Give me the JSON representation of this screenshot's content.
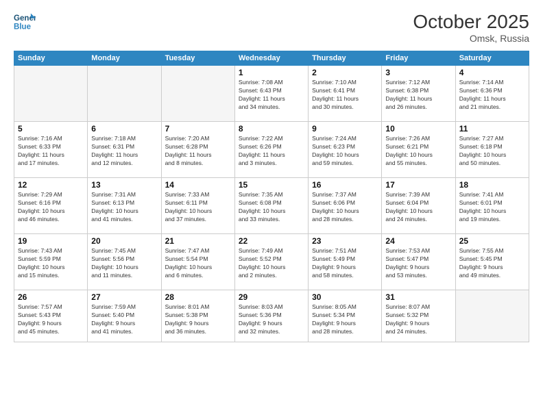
{
  "header": {
    "logo_line1": "General",
    "logo_line2": "Blue",
    "month": "October 2025",
    "location": "Omsk, Russia"
  },
  "weekdays": [
    "Sunday",
    "Monday",
    "Tuesday",
    "Wednesday",
    "Thursday",
    "Friday",
    "Saturday"
  ],
  "weeks": [
    [
      {
        "day": "",
        "info": ""
      },
      {
        "day": "",
        "info": ""
      },
      {
        "day": "",
        "info": ""
      },
      {
        "day": "1",
        "info": "Sunrise: 7:08 AM\nSunset: 6:43 PM\nDaylight: 11 hours\nand 34 minutes."
      },
      {
        "day": "2",
        "info": "Sunrise: 7:10 AM\nSunset: 6:41 PM\nDaylight: 11 hours\nand 30 minutes."
      },
      {
        "day": "3",
        "info": "Sunrise: 7:12 AM\nSunset: 6:38 PM\nDaylight: 11 hours\nand 26 minutes."
      },
      {
        "day": "4",
        "info": "Sunrise: 7:14 AM\nSunset: 6:36 PM\nDaylight: 11 hours\nand 21 minutes."
      }
    ],
    [
      {
        "day": "5",
        "info": "Sunrise: 7:16 AM\nSunset: 6:33 PM\nDaylight: 11 hours\nand 17 minutes."
      },
      {
        "day": "6",
        "info": "Sunrise: 7:18 AM\nSunset: 6:31 PM\nDaylight: 11 hours\nand 12 minutes."
      },
      {
        "day": "7",
        "info": "Sunrise: 7:20 AM\nSunset: 6:28 PM\nDaylight: 11 hours\nand 8 minutes."
      },
      {
        "day": "8",
        "info": "Sunrise: 7:22 AM\nSunset: 6:26 PM\nDaylight: 11 hours\nand 3 minutes."
      },
      {
        "day": "9",
        "info": "Sunrise: 7:24 AM\nSunset: 6:23 PM\nDaylight: 10 hours\nand 59 minutes."
      },
      {
        "day": "10",
        "info": "Sunrise: 7:26 AM\nSunset: 6:21 PM\nDaylight: 10 hours\nand 55 minutes."
      },
      {
        "day": "11",
        "info": "Sunrise: 7:27 AM\nSunset: 6:18 PM\nDaylight: 10 hours\nand 50 minutes."
      }
    ],
    [
      {
        "day": "12",
        "info": "Sunrise: 7:29 AM\nSunset: 6:16 PM\nDaylight: 10 hours\nand 46 minutes."
      },
      {
        "day": "13",
        "info": "Sunrise: 7:31 AM\nSunset: 6:13 PM\nDaylight: 10 hours\nand 41 minutes."
      },
      {
        "day": "14",
        "info": "Sunrise: 7:33 AM\nSunset: 6:11 PM\nDaylight: 10 hours\nand 37 minutes."
      },
      {
        "day": "15",
        "info": "Sunrise: 7:35 AM\nSunset: 6:08 PM\nDaylight: 10 hours\nand 33 minutes."
      },
      {
        "day": "16",
        "info": "Sunrise: 7:37 AM\nSunset: 6:06 PM\nDaylight: 10 hours\nand 28 minutes."
      },
      {
        "day": "17",
        "info": "Sunrise: 7:39 AM\nSunset: 6:04 PM\nDaylight: 10 hours\nand 24 minutes."
      },
      {
        "day": "18",
        "info": "Sunrise: 7:41 AM\nSunset: 6:01 PM\nDaylight: 10 hours\nand 19 minutes."
      }
    ],
    [
      {
        "day": "19",
        "info": "Sunrise: 7:43 AM\nSunset: 5:59 PM\nDaylight: 10 hours\nand 15 minutes."
      },
      {
        "day": "20",
        "info": "Sunrise: 7:45 AM\nSunset: 5:56 PM\nDaylight: 10 hours\nand 11 minutes."
      },
      {
        "day": "21",
        "info": "Sunrise: 7:47 AM\nSunset: 5:54 PM\nDaylight: 10 hours\nand 6 minutes."
      },
      {
        "day": "22",
        "info": "Sunrise: 7:49 AM\nSunset: 5:52 PM\nDaylight: 10 hours\nand 2 minutes."
      },
      {
        "day": "23",
        "info": "Sunrise: 7:51 AM\nSunset: 5:49 PM\nDaylight: 9 hours\nand 58 minutes."
      },
      {
        "day": "24",
        "info": "Sunrise: 7:53 AM\nSunset: 5:47 PM\nDaylight: 9 hours\nand 53 minutes."
      },
      {
        "day": "25",
        "info": "Sunrise: 7:55 AM\nSunset: 5:45 PM\nDaylight: 9 hours\nand 49 minutes."
      }
    ],
    [
      {
        "day": "26",
        "info": "Sunrise: 7:57 AM\nSunset: 5:43 PM\nDaylight: 9 hours\nand 45 minutes."
      },
      {
        "day": "27",
        "info": "Sunrise: 7:59 AM\nSunset: 5:40 PM\nDaylight: 9 hours\nand 41 minutes."
      },
      {
        "day": "28",
        "info": "Sunrise: 8:01 AM\nSunset: 5:38 PM\nDaylight: 9 hours\nand 36 minutes."
      },
      {
        "day": "29",
        "info": "Sunrise: 8:03 AM\nSunset: 5:36 PM\nDaylight: 9 hours\nand 32 minutes."
      },
      {
        "day": "30",
        "info": "Sunrise: 8:05 AM\nSunset: 5:34 PM\nDaylight: 9 hours\nand 28 minutes."
      },
      {
        "day": "31",
        "info": "Sunrise: 8:07 AM\nSunset: 5:32 PM\nDaylight: 9 hours\nand 24 minutes."
      },
      {
        "day": "",
        "info": ""
      }
    ]
  ]
}
